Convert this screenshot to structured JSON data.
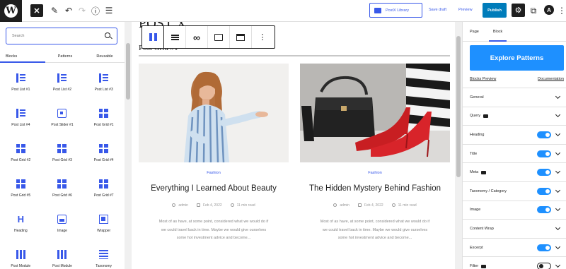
{
  "topbar": {
    "postx_library": "PostX Library",
    "save_draft": "Save draft",
    "preview": "Preview",
    "publish": "Publish"
  },
  "inserter": {
    "search_placeholder": "Search",
    "tabs": [
      "Blocks",
      "Patterns",
      "Reusable"
    ],
    "blocks": [
      {
        "label": "Post List #1",
        "icon": "post-list-icon"
      },
      {
        "label": "Post List #2",
        "icon": "post-list-icon"
      },
      {
        "label": "Post List #3",
        "icon": "post-list-icon"
      },
      {
        "label": "Post List #4",
        "icon": "post-list-icon"
      },
      {
        "label": "Post Slider #1",
        "icon": "post-slider-icon"
      },
      {
        "label": "Post Grid #1",
        "icon": "post-grid-icon"
      },
      {
        "label": "Post Grid #2",
        "icon": "post-grid-icon"
      },
      {
        "label": "Post Grid #3",
        "icon": "post-grid-icon"
      },
      {
        "label": "Post Grid #4",
        "icon": "post-grid-icon"
      },
      {
        "label": "Post Grid #5",
        "icon": "post-grid-icon"
      },
      {
        "label": "Post Grid #6",
        "icon": "post-grid-icon"
      },
      {
        "label": "Post Grid #7",
        "icon": "post-grid-icon"
      },
      {
        "label": "Heading",
        "icon": "heading-icon"
      },
      {
        "label": "Image",
        "icon": "image-icon"
      },
      {
        "label": "Wrapper",
        "icon": "wrapper-icon"
      },
      {
        "label": "Post Module",
        "icon": "post-module-icon"
      },
      {
        "label": "Post Module",
        "icon": "post-module-icon"
      },
      {
        "label": "Taxonomy",
        "icon": "taxonomy-icon"
      }
    ]
  },
  "canvas": {
    "post_title": "POST X",
    "grid_heading": "Post Grid #1",
    "cards": [
      {
        "category": "Fashion",
        "title": "Everything I Learned About Beauty",
        "author": "admin",
        "date": "Feb 4, 2022",
        "read_time": "11 min read",
        "excerpt": [
          "Most of as have, at some point, considered what we would do if",
          "we could travel back in time. Maybe we would give ourselves",
          "some hot investment advice and become..."
        ]
      },
      {
        "category": "Fashion",
        "title": "The Hidden Mystery Behind Fashion",
        "author": "admin",
        "date": "Feb 4, 2022",
        "read_time": "11 min read",
        "excerpt": [
          "Most of as have, at some point, considered what we would do if",
          "we could travel back in time. Maybe we would give ourselves",
          "some hot investment advice and become..."
        ]
      }
    ]
  },
  "settings": {
    "tabs": [
      "Page",
      "Block"
    ],
    "explore_button": "Explore Patterns",
    "blocks_preview": "Blocks Preview",
    "documentation": "Documentation",
    "panels": [
      {
        "label": "General",
        "control": "chevron",
        "pro": false
      },
      {
        "label": "Query",
        "control": "chevron",
        "pro": true
      },
      {
        "label": "Heading",
        "control": "toggle-on",
        "pro": false
      },
      {
        "label": "Title",
        "control": "toggle-on",
        "pro": false
      },
      {
        "label": "Meta",
        "control": "toggle-on",
        "pro": true
      },
      {
        "label": "Taxonomy / Category",
        "control": "toggle-on",
        "pro": false
      },
      {
        "label": "Image",
        "control": "toggle-on",
        "pro": false
      },
      {
        "label": "Content Wrap",
        "control": "chevron",
        "pro": false
      },
      {
        "label": "Excerpt",
        "control": "toggle-on",
        "pro": false
      },
      {
        "label": "Filter",
        "control": "toggle-off",
        "pro": true
      }
    ]
  },
  "colors": {
    "accent": "#3858e9",
    "publish": "#007cba",
    "explore": "#1e90ff"
  }
}
